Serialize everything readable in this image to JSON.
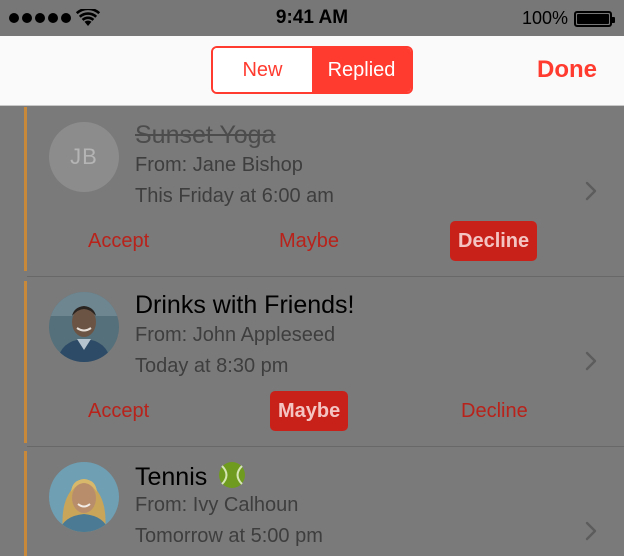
{
  "status_bar": {
    "time": "9:41 AM",
    "battery_percent": "100%",
    "signal_bars": 5,
    "icons": [
      "signal-dots-icon",
      "wifi-icon",
      "battery-icon"
    ]
  },
  "nav": {
    "segments": [
      "New",
      "Replied"
    ],
    "selected_segment": "Replied",
    "done_label": "Done"
  },
  "colors": {
    "accent": "#ff3b30",
    "rsvp_bar": "#c88a3a",
    "action_text": "#b8221a",
    "selected_action_bg": "#c8211a"
  },
  "invitations": [
    {
      "title": "Sunset Yoga",
      "title_struck": true,
      "from": "From: Jane Bishop",
      "when": "This Friday at 6:00 am",
      "avatar": {
        "type": "initials",
        "initials": "JB"
      },
      "actions": {
        "accept": "Accept",
        "maybe": "Maybe",
        "decline": "Decline"
      },
      "selected_action": "decline"
    },
    {
      "title": "Drinks with Friends!",
      "title_struck": false,
      "from": "From: John Appleseed",
      "when": "Today at 8:30 pm",
      "avatar": {
        "type": "photo",
        "icon": "man-portrait-icon"
      },
      "actions": {
        "accept": "Accept",
        "maybe": "Maybe",
        "decline": "Decline"
      },
      "selected_action": "maybe"
    },
    {
      "title": "Tennis",
      "title_emoji_icon": "tennis-ball-icon",
      "title_struck": false,
      "from": "From: Ivy Calhoun",
      "when": "Tomorrow at 5:00 pm",
      "avatar": {
        "type": "photo",
        "icon": "woman-portrait-icon"
      }
    }
  ]
}
